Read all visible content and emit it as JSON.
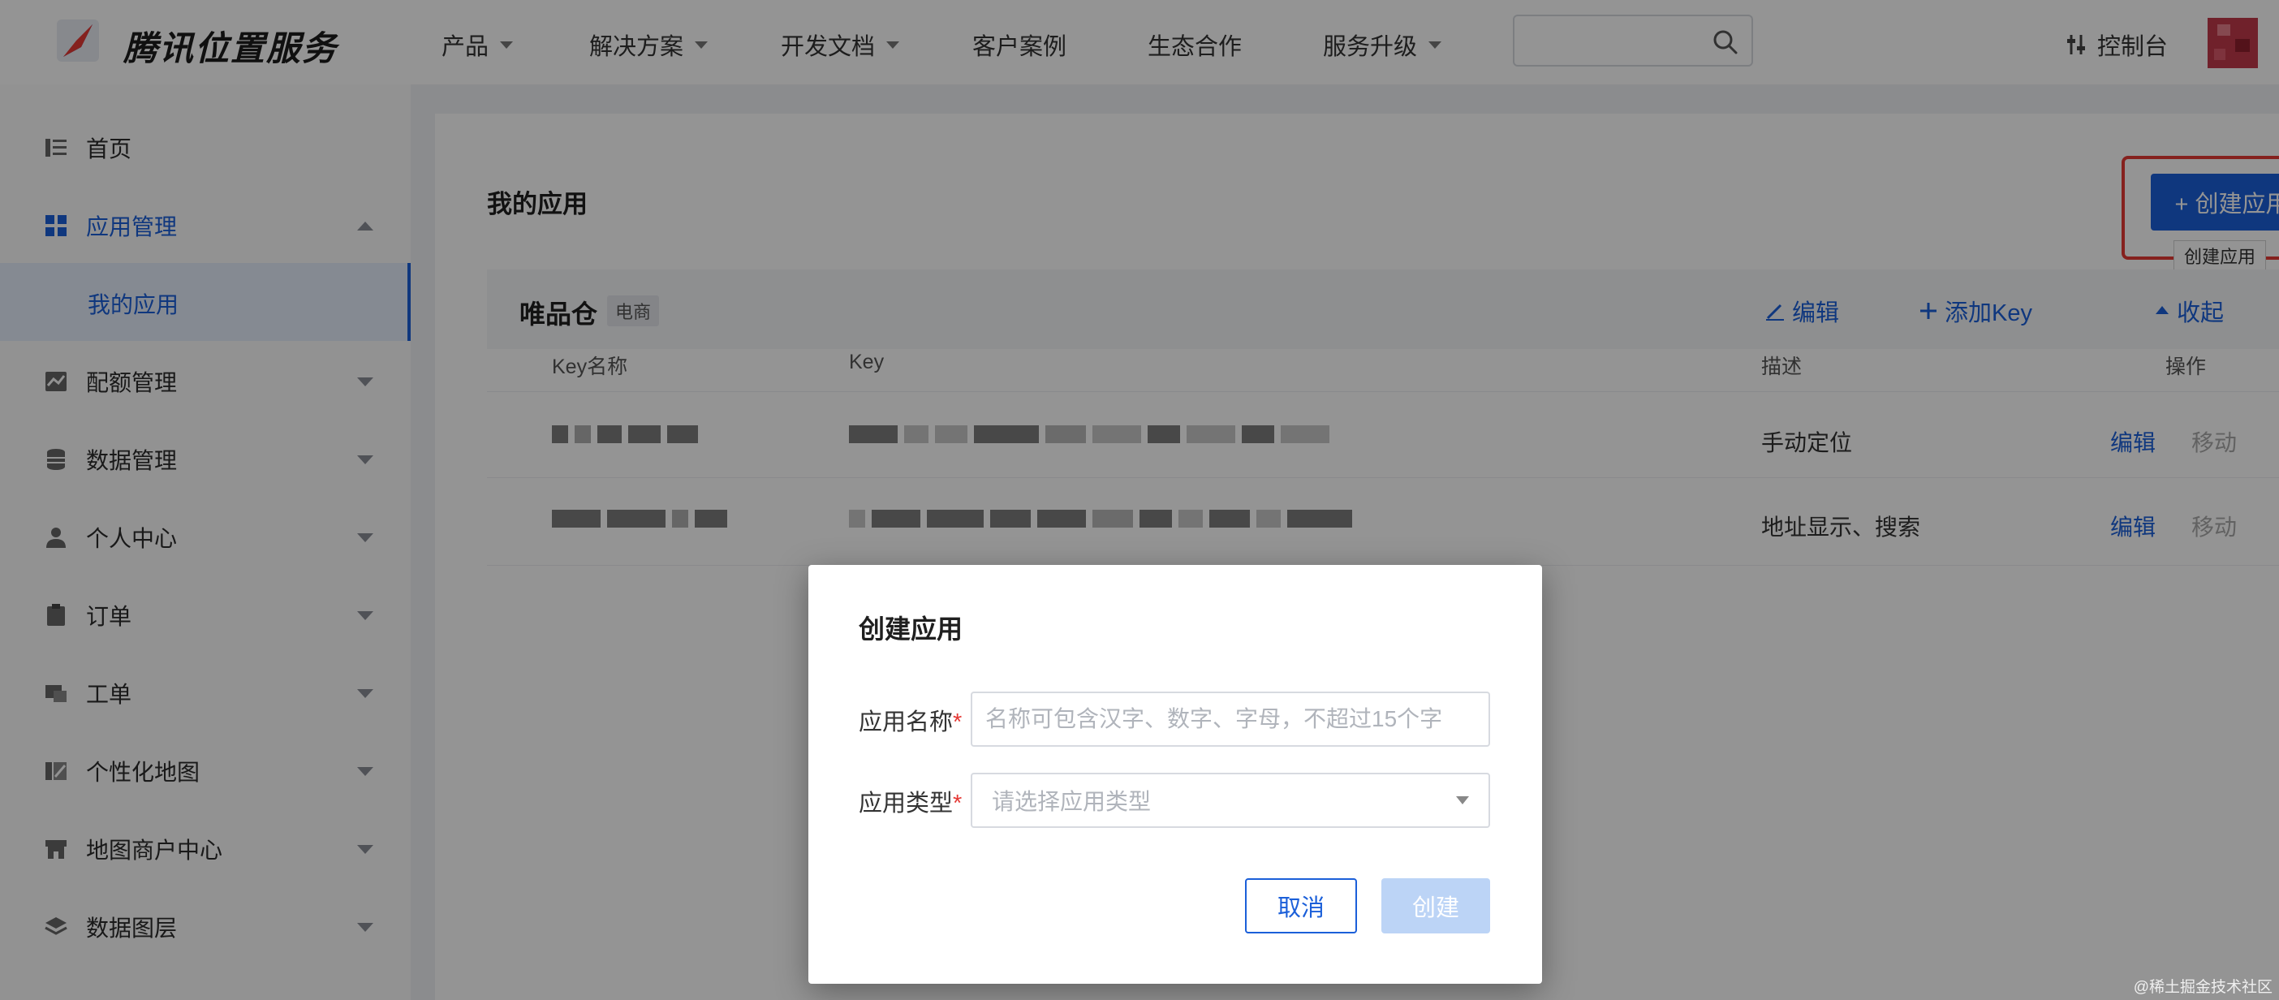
{
  "brand": {
    "name": "腾讯位置服务"
  },
  "nav": {
    "items": [
      {
        "label": "产品",
        "caret": true
      },
      {
        "label": "解决方案",
        "caret": true
      },
      {
        "label": "开发文档",
        "caret": true
      },
      {
        "label": "客户案例",
        "caret": false
      },
      {
        "label": "生态合作",
        "caret": false
      },
      {
        "label": "服务升级",
        "caret": true
      }
    ],
    "search_placeholder": "",
    "console_label": "控制台"
  },
  "sidebar": {
    "items": [
      {
        "label": "首页",
        "icon": "list-icon"
      },
      {
        "label": "应用管理",
        "icon": "grid-icon"
      },
      {
        "label": "配额管理",
        "icon": "quota-icon"
      },
      {
        "label": "数据管理",
        "icon": "database-icon"
      },
      {
        "label": "个人中心",
        "icon": "user-icon"
      },
      {
        "label": "订单",
        "icon": "clipboard-icon"
      },
      {
        "label": "工单",
        "icon": "ticket-icon"
      },
      {
        "label": "个性化地图",
        "icon": "map-style-icon"
      },
      {
        "label": "地图商户中心",
        "icon": "store-icon"
      },
      {
        "label": "数据图层",
        "icon": "layers-icon"
      }
    ],
    "sub_item": "我的应用"
  },
  "main": {
    "title": "我的应用",
    "create_button": "+ 创建应用",
    "tooltip": "创建应用",
    "app": {
      "name": "唯品仓",
      "tag": "电商",
      "actions": {
        "edit": "编辑",
        "add_key": "添加Key",
        "collapse": "收起"
      }
    },
    "table": {
      "headers": {
        "key_name": "Key名称",
        "key": "Key",
        "desc": "描述",
        "ops": "操作"
      },
      "rows": [
        {
          "desc": "手动定位",
          "edit": "编辑",
          "move": "移动"
        },
        {
          "desc": "地址显示、搜索",
          "edit": "编辑",
          "move": "移动"
        }
      ]
    }
  },
  "dialog": {
    "title": "创建应用",
    "name_label": "应用名称",
    "name_placeholder": "名称可包含汉字、数字、字母，不超过15个字",
    "type_label": "应用类型",
    "type_placeholder": "请选择应用类型",
    "required_mark": "*",
    "cancel": "取消",
    "create": "创建"
  },
  "watermark": "@稀土掘金技术社区",
  "colors": {
    "accent": "#1b5fd9",
    "highlight": "#e53935"
  }
}
